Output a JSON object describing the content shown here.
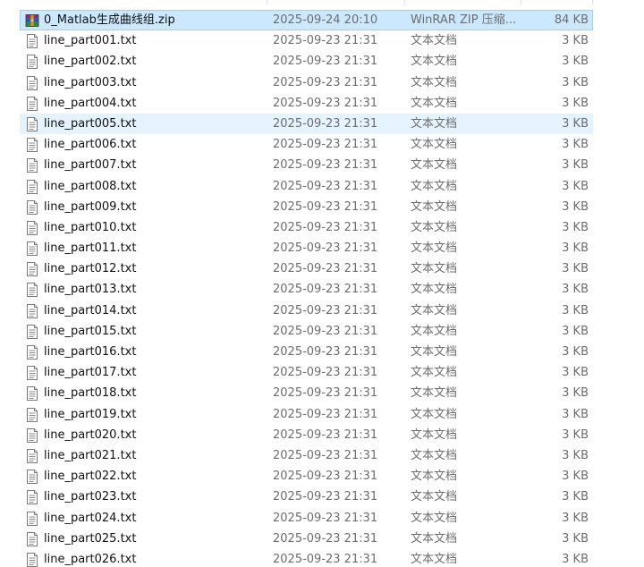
{
  "files": [
    {
      "name": "0_Matlab生成曲线组.zip",
      "date": "2025-09-24 20:10",
      "type": "WinRAR ZIP 压缩...",
      "size": "84 KB",
      "icon": "winrar-archive-icon",
      "state": "selected"
    },
    {
      "name": "line_part001.txt",
      "date": "2025-09-23 21:31",
      "type": "文本文档",
      "size": "3 KB",
      "icon": "text-file-icon",
      "state": ""
    },
    {
      "name": "line_part002.txt",
      "date": "2025-09-23 21:31",
      "type": "文本文档",
      "size": "3 KB",
      "icon": "text-file-icon",
      "state": ""
    },
    {
      "name": "line_part003.txt",
      "date": "2025-09-23 21:31",
      "type": "文本文档",
      "size": "3 KB",
      "icon": "text-file-icon",
      "state": ""
    },
    {
      "name": "line_part004.txt",
      "date": "2025-09-23 21:31",
      "type": "文本文档",
      "size": "3 KB",
      "icon": "text-file-icon",
      "state": ""
    },
    {
      "name": "line_part005.txt",
      "date": "2025-09-23 21:31",
      "type": "文本文档",
      "size": "3 KB",
      "icon": "text-file-icon",
      "state": "hover"
    },
    {
      "name": "line_part006.txt",
      "date": "2025-09-23 21:31",
      "type": "文本文档",
      "size": "3 KB",
      "icon": "text-file-icon",
      "state": ""
    },
    {
      "name": "line_part007.txt",
      "date": "2025-09-23 21:31",
      "type": "文本文档",
      "size": "3 KB",
      "icon": "text-file-icon",
      "state": ""
    },
    {
      "name": "line_part008.txt",
      "date": "2025-09-23 21:31",
      "type": "文本文档",
      "size": "3 KB",
      "icon": "text-file-icon",
      "state": ""
    },
    {
      "name": "line_part009.txt",
      "date": "2025-09-23 21:31",
      "type": "文本文档",
      "size": "3 KB",
      "icon": "text-file-icon",
      "state": ""
    },
    {
      "name": "line_part010.txt",
      "date": "2025-09-23 21:31",
      "type": "文本文档",
      "size": "3 KB",
      "icon": "text-file-icon",
      "state": ""
    },
    {
      "name": "line_part011.txt",
      "date": "2025-09-23 21:31",
      "type": "文本文档",
      "size": "3 KB",
      "icon": "text-file-icon",
      "state": ""
    },
    {
      "name": "line_part012.txt",
      "date": "2025-09-23 21:31",
      "type": "文本文档",
      "size": "3 KB",
      "icon": "text-file-icon",
      "state": ""
    },
    {
      "name": "line_part013.txt",
      "date": "2025-09-23 21:31",
      "type": "文本文档",
      "size": "3 KB",
      "icon": "text-file-icon",
      "state": ""
    },
    {
      "name": "line_part014.txt",
      "date": "2025-09-23 21:31",
      "type": "文本文档",
      "size": "3 KB",
      "icon": "text-file-icon",
      "state": ""
    },
    {
      "name": "line_part015.txt",
      "date": "2025-09-23 21:31",
      "type": "文本文档",
      "size": "3 KB",
      "icon": "text-file-icon",
      "state": ""
    },
    {
      "name": "line_part016.txt",
      "date": "2025-09-23 21:31",
      "type": "文本文档",
      "size": "3 KB",
      "icon": "text-file-icon",
      "state": ""
    },
    {
      "name": "line_part017.txt",
      "date": "2025-09-23 21:31",
      "type": "文本文档",
      "size": "3 KB",
      "icon": "text-file-icon",
      "state": ""
    },
    {
      "name": "line_part018.txt",
      "date": "2025-09-23 21:31",
      "type": "文本文档",
      "size": "3 KB",
      "icon": "text-file-icon",
      "state": ""
    },
    {
      "name": "line_part019.txt",
      "date": "2025-09-23 21:31",
      "type": "文本文档",
      "size": "3 KB",
      "icon": "text-file-icon",
      "state": ""
    },
    {
      "name": "line_part020.txt",
      "date": "2025-09-23 21:31",
      "type": "文本文档",
      "size": "3 KB",
      "icon": "text-file-icon",
      "state": ""
    },
    {
      "name": "line_part021.txt",
      "date": "2025-09-23 21:31",
      "type": "文本文档",
      "size": "3 KB",
      "icon": "text-file-icon",
      "state": ""
    },
    {
      "name": "line_part022.txt",
      "date": "2025-09-23 21:31",
      "type": "文本文档",
      "size": "3 KB",
      "icon": "text-file-icon",
      "state": ""
    },
    {
      "name": "line_part023.txt",
      "date": "2025-09-23 21:31",
      "type": "文本文档",
      "size": "3 KB",
      "icon": "text-file-icon",
      "state": ""
    },
    {
      "name": "line_part024.txt",
      "date": "2025-09-23 21:31",
      "type": "文本文档",
      "size": "3 KB",
      "icon": "text-file-icon",
      "state": ""
    },
    {
      "name": "line_part025.txt",
      "date": "2025-09-23 21:31",
      "type": "文本文档",
      "size": "3 KB",
      "icon": "text-file-icon",
      "state": ""
    },
    {
      "name": "line_part026.txt",
      "date": "2025-09-23 21:31",
      "type": "文本文档",
      "size": "3 KB",
      "icon": "text-file-icon",
      "state": ""
    }
  ],
  "colors": {
    "selected_bg": "#cce8ff",
    "selected_border": "#99d1ff",
    "hover_bg": "#e5f3ff",
    "secondary_text": "#6d6d6d"
  }
}
